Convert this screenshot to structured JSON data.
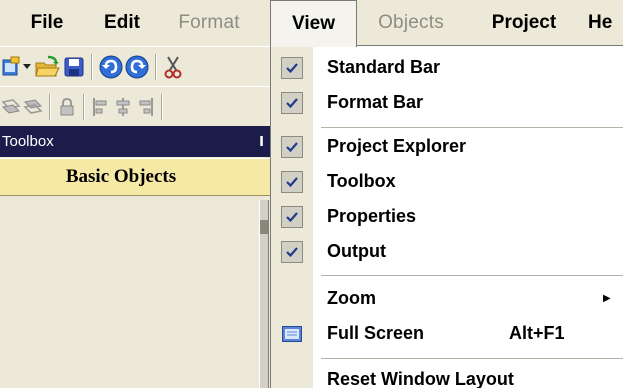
{
  "menubar": {
    "items": [
      {
        "label": "File",
        "state": "normal"
      },
      {
        "label": "Edit",
        "state": "normal"
      },
      {
        "label": "Format",
        "state": "disabled"
      },
      {
        "label": "View",
        "state": "active"
      },
      {
        "label": "Objects",
        "state": "disabled"
      },
      {
        "label": "Project",
        "state": "normal"
      },
      {
        "label": "He",
        "state": "normal"
      }
    ]
  },
  "toolbar_standard": {
    "icons": [
      "new-screen-icon",
      "dropdown-arrow-icon",
      "open-folder-icon",
      "save-icon",
      "undo-icon",
      "redo-icon",
      "cut-icon"
    ]
  },
  "toolbar_format": {
    "icons": [
      "bring-front-icon",
      "send-back-icon",
      "lock-icon",
      "align-left-icon",
      "align-center-icon",
      "align-right-icon"
    ]
  },
  "toolbox": {
    "title": "Toolbox",
    "pin_glyph": "Ⅰ",
    "section": "Basic Objects"
  },
  "view_menu": {
    "items": [
      {
        "label": "Standard Bar",
        "checked": true
      },
      {
        "label": "Format Bar",
        "checked": true
      },
      {
        "label": "Project Explorer",
        "checked": true
      },
      {
        "label": "Toolbox",
        "checked": true
      },
      {
        "label": "Properties",
        "checked": true
      },
      {
        "label": "Output",
        "checked": true
      },
      {
        "label": "Zoom",
        "submenu": true
      },
      {
        "label": "Full Screen",
        "shortcut": "Alt+F1",
        "icon": "full-screen-icon"
      },
      {
        "label": "Reset Window Layout"
      }
    ]
  },
  "colors": {
    "toolbox_header": "#1c1c4a",
    "section_bg": "#f5e9a5",
    "menu_bg": "#ece9d8",
    "check_blue": "#1f3b8c"
  }
}
